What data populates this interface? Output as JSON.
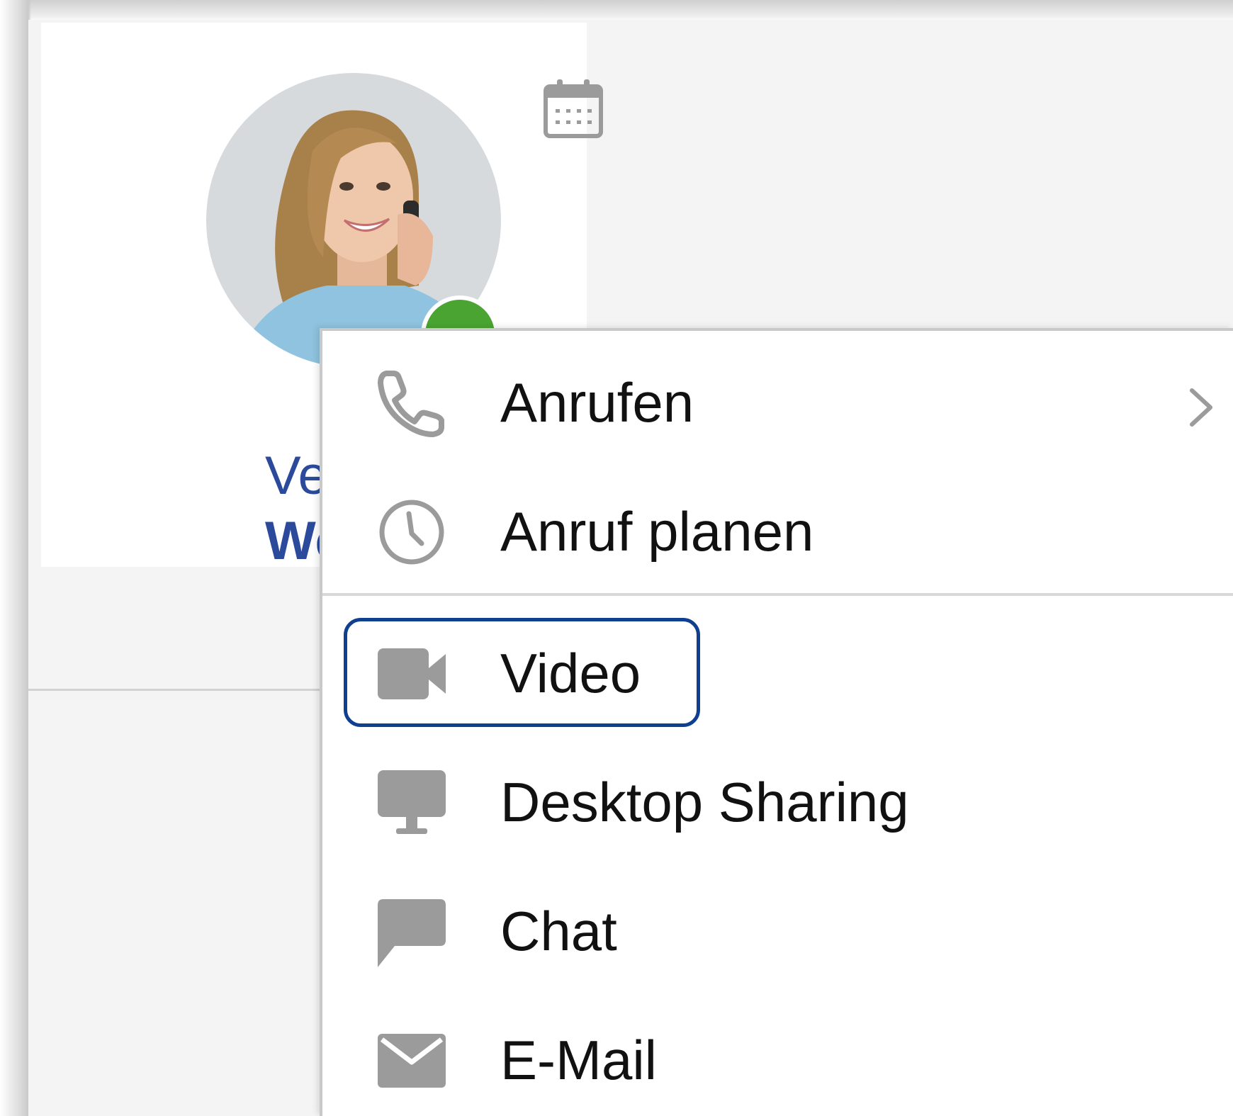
{
  "contact": {
    "first_name": "Vere",
    "last_name": "We",
    "status": "available",
    "status_color": "#4aa432",
    "name_color": "#2b4a9b"
  },
  "icons": {
    "calendar": "calendar-icon",
    "phone": "phone-icon",
    "clock": "clock-icon",
    "video": "video-camera-icon",
    "desktop": "monitor-icon",
    "chat": "chat-bubble-icon",
    "email": "envelope-icon",
    "submenu": "chevron-right-icon"
  },
  "menu": {
    "items": [
      {
        "label": "Anrufen",
        "icon": "phone-icon",
        "has_submenu": true
      },
      {
        "label": "Anruf planen",
        "icon": "clock-icon",
        "has_submenu": false
      },
      {
        "label": "Video",
        "icon": "video-camera-icon",
        "has_submenu": false,
        "focused": true
      },
      {
        "label": "Desktop Sharing",
        "icon": "monitor-icon",
        "has_submenu": false
      },
      {
        "label": "Chat",
        "icon": "chat-bubble-icon",
        "has_submenu": false
      },
      {
        "label": "E-Mail",
        "icon": "envelope-icon",
        "has_submenu": false
      }
    ],
    "focus_color": "#0f3f8f",
    "icon_color": "#9b9b9b"
  }
}
